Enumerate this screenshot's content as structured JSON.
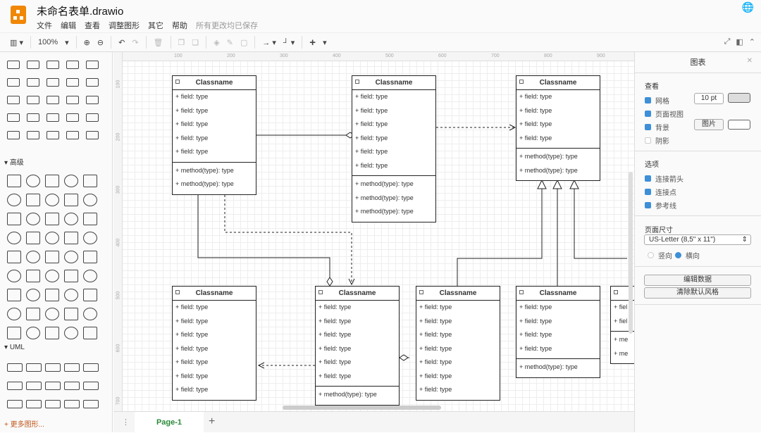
{
  "app": {
    "title": "未命名表单.drawio",
    "menu": [
      "文件",
      "编辑",
      "查看",
      "调整图形",
      "其它",
      "帮助"
    ],
    "status": "所有更改均已保存"
  },
  "toolbar": {
    "zoom": "100%"
  },
  "sidebar": {
    "sections": [
      "高级",
      "UML"
    ],
    "more": "+ 更多图形..."
  },
  "rulers": {
    "h": [
      "100",
      "200",
      "300",
      "400",
      "500",
      "600",
      "700",
      "800",
      "900"
    ],
    "v": [
      "100",
      "200",
      "300",
      "400",
      "500",
      "600",
      "700"
    ]
  },
  "classes": [
    {
      "name": "Classname",
      "fields": [
        "+ field: type",
        "+ field: type",
        "+ field: type",
        "+ field: type",
        "+ field: type"
      ],
      "methods": [
        "+ method(type): type",
        "+ method(type): type"
      ]
    },
    {
      "name": "Classname",
      "fields": [
        "+ field: type",
        "+ field: type",
        "+ field: type",
        "+ field: type",
        "+ field: type",
        "+ field: type"
      ],
      "methods": [
        "+ method(type): type",
        "+ method(type): type",
        "+ method(type): type"
      ]
    },
    {
      "name": "Classname",
      "fields": [
        "+ field: type",
        "+ field: type",
        "+ field: type",
        "+ field: type"
      ],
      "methods": [
        "+ method(type): type",
        "+ method(type): type"
      ]
    },
    {
      "name": "Classname",
      "fields": [
        "+ field: type",
        "+ field: type",
        "+ field: type",
        "+ field: type",
        "+ field: type",
        "+ field: type",
        "+ field: type"
      ],
      "methods": []
    },
    {
      "name": "Classname",
      "fields": [
        "+ field: type",
        "+ field: type",
        "+ field: type",
        "+ field: type",
        "+ field: type",
        "+ field: type"
      ],
      "methods": [
        "+ method(type): type"
      ]
    },
    {
      "name": "Classname",
      "fields": [
        "+ field: type",
        "+ field: type",
        "+ field: type",
        "+ field: type",
        "+ field: type",
        "+ field: type",
        "+ field: type"
      ],
      "methods": []
    },
    {
      "name": "Classname",
      "fields": [
        "+ field: type",
        "+ field: type",
        "+ field: type",
        "+ field: type"
      ],
      "methods": [
        "+ method(type): type"
      ]
    },
    {
      "name": "",
      "fields": [
        "+ fiel",
        "+ fiel"
      ],
      "methods": [
        "+ me",
        "+ me"
      ]
    }
  ],
  "pages": {
    "tab": "Page-1"
  },
  "panel": {
    "title": "图表",
    "view": "查看",
    "grid": "网格",
    "grid_size": "10 pt",
    "page_view": "页面视图",
    "background": "背景",
    "image_btn": "图片",
    "shadow": "阴影",
    "options": "选项",
    "conn_arrows": "连接箭头",
    "conn_points": "连接点",
    "guides": "参考线",
    "page_size": "页面尺寸",
    "paper": "US-Letter (8,5\" x 11\")",
    "portrait": "竖向",
    "landscape": "横向",
    "edit_data": "编辑数据",
    "clear_style": "清除默认风格"
  }
}
